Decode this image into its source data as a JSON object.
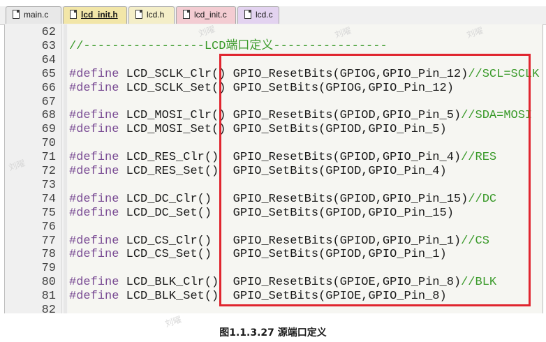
{
  "tabs": [
    {
      "label": "main.c",
      "bg": "#e8e8e8",
      "active": false
    },
    {
      "label": "lcd_init.h",
      "bg": "#f2e6a8",
      "active": true
    },
    {
      "label": "lcd.h",
      "bg": "#f4eec8",
      "active": false
    },
    {
      "label": "lcd_init.c",
      "bg": "#f3ccd2",
      "active": false
    },
    {
      "label": "lcd.c",
      "bg": "#e3d3f0",
      "active": false
    }
  ],
  "colors": {
    "keyword": "#7a4c94",
    "comment": "#3a9a2a",
    "highlight_box": "#e0252f"
  },
  "code_lines": [
    {
      "n": "62",
      "kw": "",
      "tx": "",
      "cm": ""
    },
    {
      "n": "63",
      "kw": "",
      "tx": "",
      "cm": "//-----------------LCD端口定义----------------"
    },
    {
      "n": "64",
      "kw": "",
      "tx": "",
      "cm": ""
    },
    {
      "n": "65",
      "kw": "#define",
      "tx": " LCD_SCLK_Clr() GPIO_ResetBits(GPIOG,GPIO_Pin_12)",
      "cm": "//SCL=SCLK"
    },
    {
      "n": "66",
      "kw": "#define",
      "tx": " LCD_SCLK_Set() GPIO_SetBits(GPIOG,GPIO_Pin_12)",
      "cm": ""
    },
    {
      "n": "67",
      "kw": "",
      "tx": "",
      "cm": ""
    },
    {
      "n": "68",
      "kw": "#define",
      "tx": " LCD_MOSI_Clr() GPIO_ResetBits(GPIOD,GPIO_Pin_5)",
      "cm": "//SDA=MOSI"
    },
    {
      "n": "69",
      "kw": "#define",
      "tx": " LCD_MOSI_Set() GPIO_SetBits(GPIOD,GPIO_Pin_5)",
      "cm": ""
    },
    {
      "n": "70",
      "kw": "",
      "tx": "",
      "cm": ""
    },
    {
      "n": "71",
      "kw": "#define",
      "tx": " LCD_RES_Clr()  GPIO_ResetBits(GPIOD,GPIO_Pin_4)",
      "cm": "//RES"
    },
    {
      "n": "72",
      "kw": "#define",
      "tx": " LCD_RES_Set()  GPIO_SetBits(GPIOD,GPIO_Pin_4)",
      "cm": ""
    },
    {
      "n": "73",
      "kw": "",
      "tx": "",
      "cm": ""
    },
    {
      "n": "74",
      "kw": "#define",
      "tx": " LCD_DC_Clr()   GPIO_ResetBits(GPIOD,GPIO_Pin_15)",
      "cm": "//DC"
    },
    {
      "n": "75",
      "kw": "#define",
      "tx": " LCD_DC_Set()   GPIO_SetBits(GPIOD,GPIO_Pin_15)",
      "cm": ""
    },
    {
      "n": "76",
      "kw": "",
      "tx": "",
      "cm": ""
    },
    {
      "n": "77",
      "kw": "#define",
      "tx": " LCD_CS_Clr()   GPIO_ResetBits(GPIOD,GPIO_Pin_1)",
      "cm": "//CS"
    },
    {
      "n": "78",
      "kw": "#define",
      "tx": " LCD_CS_Set()   GPIO_SetBits(GPIOD,GPIO_Pin_1)",
      "cm": ""
    },
    {
      "n": "79",
      "kw": "",
      "tx": "",
      "cm": ""
    },
    {
      "n": "80",
      "kw": "#define",
      "tx": " LCD_BLK_Clr()  GPIO_ResetBits(GPIOE,GPIO_Pin_8)",
      "cm": "//BLK"
    },
    {
      "n": "81",
      "kw": "#define",
      "tx": " LCD_BLK_Set()  GPIO_SetBits(GPIOE,GPIO_Pin_8)",
      "cm": ""
    },
    {
      "n": "82",
      "kw": "",
      "tx": "",
      "cm": ""
    }
  ],
  "watermark": "刘曜",
  "caption": "图1.1.3.27 源端口定义"
}
